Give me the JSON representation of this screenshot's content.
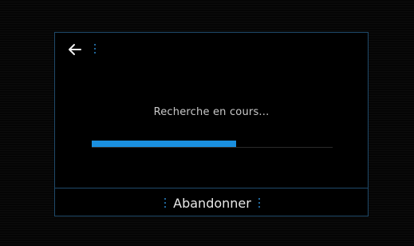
{
  "screen": {
    "back_icon": "back-arrow-icon",
    "accent_color": "#1a8fdf",
    "border_color": "#1f4a6a"
  },
  "search": {
    "status_text": "Recherche en cours...",
    "progress": 0.6
  },
  "footer": {
    "abort_label": "Abandonner"
  }
}
